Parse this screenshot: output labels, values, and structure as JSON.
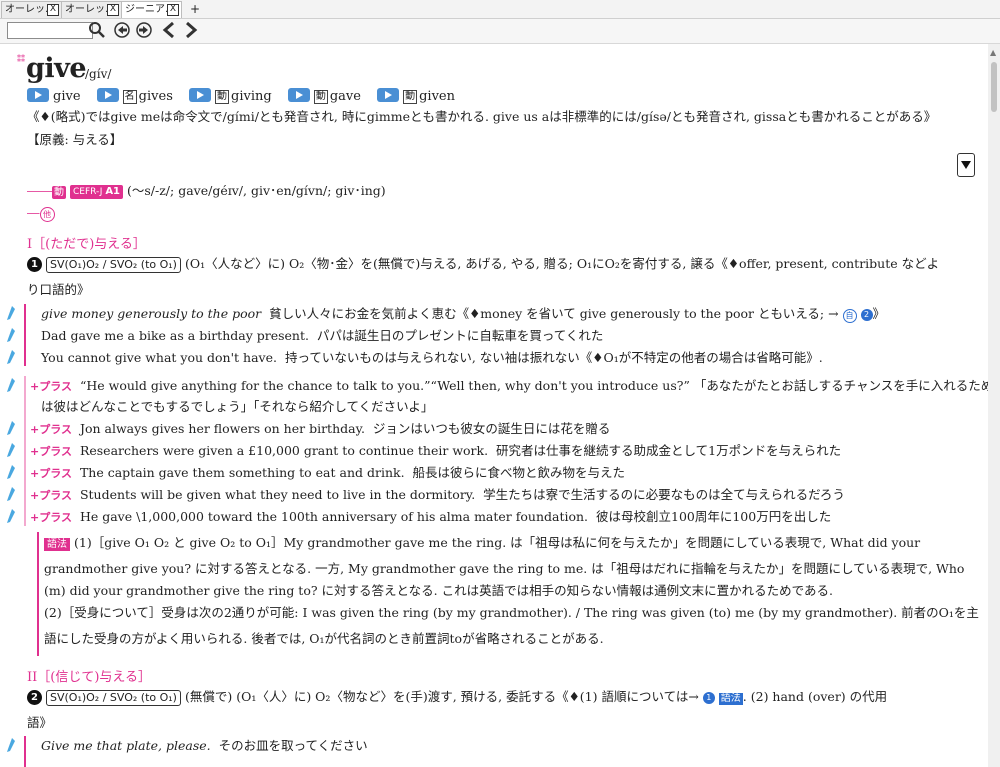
{
  "tabs": [
    {
      "label": "オーレッ…",
      "close": "X"
    },
    {
      "label": "オーレッ…",
      "close": "X"
    },
    {
      "label": "ジーニア…",
      "close": "X"
    }
  ],
  "tab_add": "+",
  "search": {
    "value": ""
  },
  "entry": {
    "headword": "give",
    "stars": "⁑⁑",
    "pronunciation": "/gív/",
    "forms": [
      {
        "pos": "",
        "word": "give"
      },
      {
        "pos": "名",
        "word": "gives"
      },
      {
        "pos": "動",
        "word": "giving"
      },
      {
        "pos": "動",
        "word": "gave"
      },
      {
        "pos": "動",
        "word": "given"
      }
    ],
    "note_text": "《♦(略式)ではgive meは命令文で/gími/とも発音され, 時にgimmeとも書かれる. give us aは非標準的には/gísə/とも発音され, gissaとも書かれることがある》",
    "origin": "【原義: 与える】",
    "verb_pos": "動",
    "cefr_label": "CEFR-J",
    "cefr_level": "A1",
    "inflection": "(～s/-z/; gave/géɪv/, giv･en/gívn/; giv･ing)",
    "dash_main": "――",
    "dash_sub": "―",
    "sub_pos": "他"
  },
  "sense1": {
    "head": "I［(ただで)与える］",
    "num": "1",
    "pattern": "SV(O₁)O₂ / SVO₂ (to O₁)",
    "def_line1": "(O₁〈人など〉に) O₂〈物･金〉を(無償で)与える, あげる, やる, 贈る; O₁にO₂を寄付する, 譲る《♦offer, present, contribute などよ",
    "def_line2": "り口語的》",
    "examples": [
      {
        "en": "give money generously to the poor",
        "ja": "貧しい人々にお金を気前よく恵む《♦money を省いて give generously to the poor ともいえる; →",
        "ref": "自",
        "refnum": "2",
        "tail": "》"
      },
      {
        "en": "Dad gave me a bike as a birthday present.",
        "ja": "パパは誕生日のプレゼントに自転車を買ってくれた"
      },
      {
        "en": "You cannot give what you don't have.",
        "ja": "持っていないものは与えられない, ない袖は振れない《♦O₁が不特定の他者の場合は省略可能》."
      }
    ],
    "plus_label": "+プラス",
    "plus_examples": [
      {
        "en": "“He would give anything for the chance to talk to you.”“Well then, why don't you introduce us?”",
        "ja": "「あなたがたとお話しするチャンスを手に入れるために",
        "ja2": "は彼はどんなことでもするでしょう」「それなら紹介してくださいよ」"
      },
      {
        "en": "Jon always gives her flowers on her birthday.",
        "ja": "ジョンはいつも彼女の誕生日には花を贈る"
      },
      {
        "en": "Researchers were given a £10,000 grant to continue their work.",
        "ja": "研究者は仕事を継続する助成金として1万ポンドを与えられた"
      },
      {
        "en": "The captain gave them something to eat and drink.",
        "ja": "船長は彼らに食べ物と飲み物を与えた"
      },
      {
        "en": "Students will be given what they need to live in the dormitory.",
        "ja": "学生たちは寮で生活するのに必要なものは全て与えられるだろう"
      },
      {
        "en": "He gave \\1,000,000 toward the 100th anniversary of his alma mater foundation.",
        "ja": "彼は母校創立100周年に100万円を出した"
      }
    ],
    "usage_label": "語法",
    "usage1_l1": "(1)［give O₁ O₂ と give O₂ to O₁］My grandmother gave me the ring. は「祖母は私に何を与えたか」を問題にしている表現で, What did your",
    "usage1_l2": "grandmother give you? に対する答えとなる. 一方, My grandmother gave the ring to me. は「祖母はだれに指輪を与えたか」を問題にしている表現で, Who",
    "usage1_l3": "(m) did your grandmother give the ring to? に対する答えとなる. これは英語では相手の知らない情報は通例文末に置かれるためである.",
    "usage2_l1": "(2)［受身について］受身は次の2通りが可能: I was given the ring (by my grandmother). / The ring was given (to) me (by my grandmother). 前者のO₁を主",
    "usage2_l2": "語にした受身の方がよく用いられる. 後者では, O₁が代名詞のとき前置詞toが省略されることがある."
  },
  "sense2": {
    "head": "II［(信じて)与える］",
    "num": "2",
    "pattern": "SV(O₁)O₂ / SVO₂ (to O₁)",
    "def_line1": "(無償で) (O₁〈人〉に) O₂〈物など〉を(手)渡す, 預ける, 委託する《♦(1) 語順については→",
    "def_ref_num": "1",
    "def_ref_box": "語法",
    "def_tail": ". (2) hand (over) の代用",
    "def_line2": "語》",
    "example": {
      "en": "Give me that plate, please.",
      "ja": "そのお皿を取ってください"
    }
  }
}
